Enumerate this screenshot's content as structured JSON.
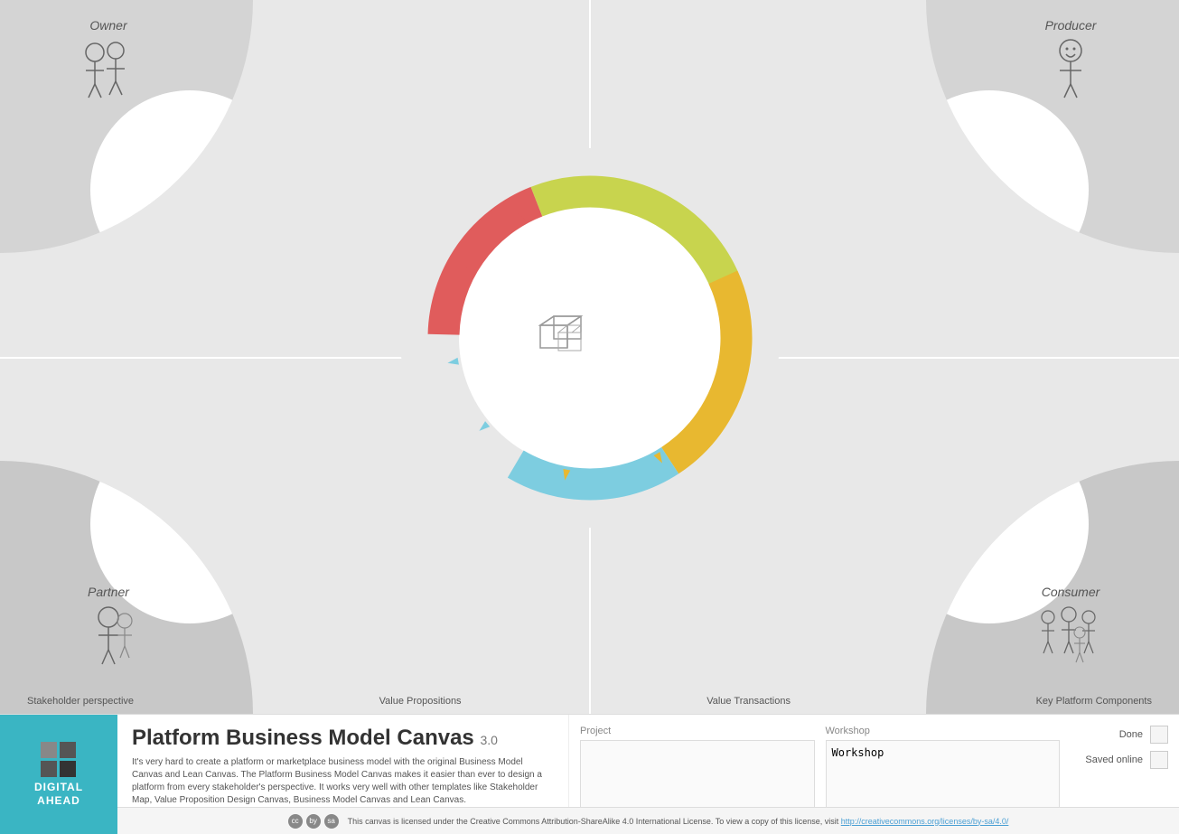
{
  "title": "Platform Business Model Canvas",
  "version": "3.0",
  "description": "It's very hard to create a platform or marketplace business model with the original Business Model Canvas and Lean Canvas. The Platform Business Model Canvas makes it easier than ever to design a platform from every stakeholder's perspective. It works very well with other templates like Stakeholder Map, Value Proposition Design Canvas, Business Model Canvas and Lean Canvas.",
  "stakeholders": {
    "owner": {
      "name": "Owner",
      "position": "top-left"
    },
    "producer": {
      "name": "Producer",
      "position": "top-right"
    },
    "partner": {
      "name": "Partner",
      "position": "bottom-left"
    },
    "consumer": {
      "name": "Consumer",
      "position": "bottom-right"
    }
  },
  "labels": {
    "stakeholder_perspective": "Stakeholder perspective",
    "value_propositions": "Value Propositions",
    "value_transactions": "Value Transactions",
    "key_platform_components": "Key Platform Components"
  },
  "ring_segments": {
    "red": "#e05c5c",
    "yellow_green": "#c8d44e",
    "yellow": "#e8b830",
    "light_blue": "#7dcde0"
  },
  "fields": {
    "project_label": "Project",
    "project_value": "",
    "workshop_label": "Workshop",
    "workshop_value": "Workshop"
  },
  "status": {
    "done_label": "Done",
    "saved_label": "Saved online"
  },
  "brand": {
    "name": "DIGITAL\nAHEAD",
    "accent_color": "#3ab5c3"
  },
  "license": {
    "text": "This canvas is licensed under the Creative Commons Attribution-ShareAlike 4.0 International License.",
    "link_text": "http://creativecommons.org/licenses/by-sa/4.0/",
    "view_text": "To view a copy of this license, visit"
  }
}
